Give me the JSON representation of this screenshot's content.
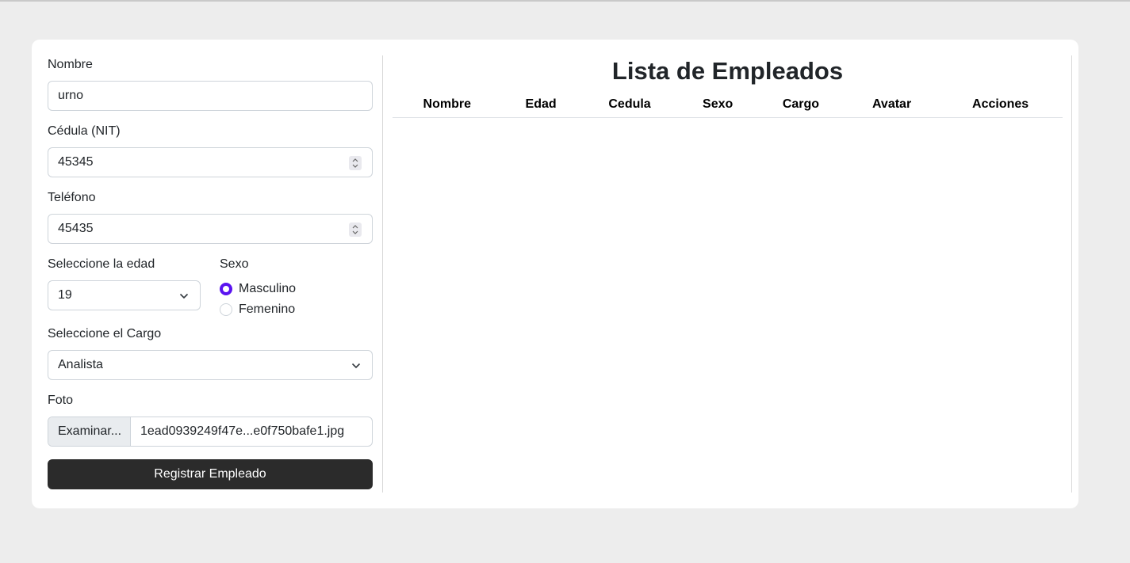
{
  "form": {
    "nombre_label": "Nombre",
    "nombre_value": "urno",
    "cedula_label": "Cédula (NIT)",
    "cedula_value": "45345",
    "telefono_label": "Teléfono",
    "telefono_value": "45435",
    "edad_label": "Seleccione la edad",
    "edad_value": "19",
    "sexo_label": "Sexo",
    "sexo_options": [
      "Masculino",
      "Femenino"
    ],
    "sexo_selected": "Masculino",
    "cargo_label": "Seleccione el Cargo",
    "cargo_value": "Analista",
    "foto_label": "Foto",
    "foto_button": "Examinar...",
    "foto_filename": "1ead0939249f47e...e0f750bafe1.jpg",
    "submit_label": "Registrar Empleado"
  },
  "list": {
    "title": "Lista de Empleados",
    "columns": [
      "Nombre",
      "Edad",
      "Cedula",
      "Sexo",
      "Cargo",
      "Avatar",
      "Acciones"
    ]
  },
  "colors": {
    "accent": "#5a13f0",
    "button": "#2b2b2b",
    "background": "#ededed"
  }
}
